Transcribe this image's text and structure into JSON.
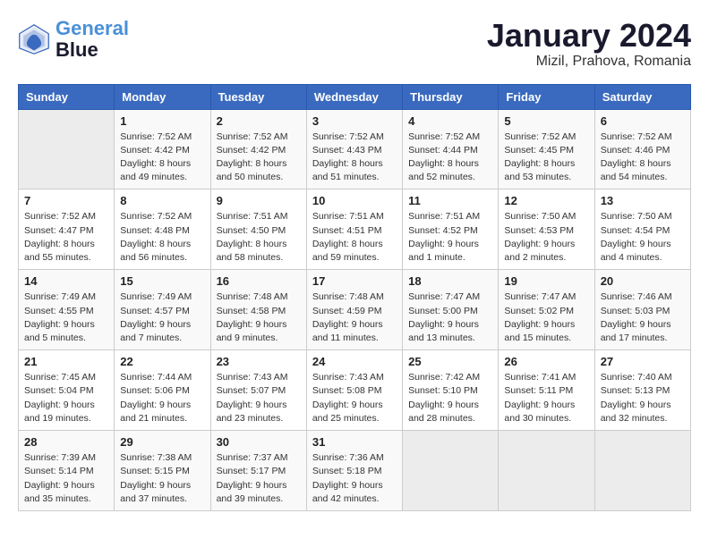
{
  "header": {
    "logo_line1": "General",
    "logo_line2": "Blue",
    "title": "January 2024",
    "subtitle": "Mizil, Prahova, Romania"
  },
  "weekdays": [
    "Sunday",
    "Monday",
    "Tuesday",
    "Wednesday",
    "Thursday",
    "Friday",
    "Saturday"
  ],
  "weeks": [
    [
      {
        "day": "",
        "sunrise": "",
        "sunset": "",
        "daylight": ""
      },
      {
        "day": "1",
        "sunrise": "Sunrise: 7:52 AM",
        "sunset": "Sunset: 4:42 PM",
        "daylight": "Daylight: 8 hours and 49 minutes."
      },
      {
        "day": "2",
        "sunrise": "Sunrise: 7:52 AM",
        "sunset": "Sunset: 4:42 PM",
        "daylight": "Daylight: 8 hours and 50 minutes."
      },
      {
        "day": "3",
        "sunrise": "Sunrise: 7:52 AM",
        "sunset": "Sunset: 4:43 PM",
        "daylight": "Daylight: 8 hours and 51 minutes."
      },
      {
        "day": "4",
        "sunrise": "Sunrise: 7:52 AM",
        "sunset": "Sunset: 4:44 PM",
        "daylight": "Daylight: 8 hours and 52 minutes."
      },
      {
        "day": "5",
        "sunrise": "Sunrise: 7:52 AM",
        "sunset": "Sunset: 4:45 PM",
        "daylight": "Daylight: 8 hours and 53 minutes."
      },
      {
        "day": "6",
        "sunrise": "Sunrise: 7:52 AM",
        "sunset": "Sunset: 4:46 PM",
        "daylight": "Daylight: 8 hours and 54 minutes."
      }
    ],
    [
      {
        "day": "7",
        "sunrise": "Sunrise: 7:52 AM",
        "sunset": "Sunset: 4:47 PM",
        "daylight": "Daylight: 8 hours and 55 minutes."
      },
      {
        "day": "8",
        "sunrise": "Sunrise: 7:52 AM",
        "sunset": "Sunset: 4:48 PM",
        "daylight": "Daylight: 8 hours and 56 minutes."
      },
      {
        "day": "9",
        "sunrise": "Sunrise: 7:51 AM",
        "sunset": "Sunset: 4:50 PM",
        "daylight": "Daylight: 8 hours and 58 minutes."
      },
      {
        "day": "10",
        "sunrise": "Sunrise: 7:51 AM",
        "sunset": "Sunset: 4:51 PM",
        "daylight": "Daylight: 8 hours and 59 minutes."
      },
      {
        "day": "11",
        "sunrise": "Sunrise: 7:51 AM",
        "sunset": "Sunset: 4:52 PM",
        "daylight": "Daylight: 9 hours and 1 minute."
      },
      {
        "day": "12",
        "sunrise": "Sunrise: 7:50 AM",
        "sunset": "Sunset: 4:53 PM",
        "daylight": "Daylight: 9 hours and 2 minutes."
      },
      {
        "day": "13",
        "sunrise": "Sunrise: 7:50 AM",
        "sunset": "Sunset: 4:54 PM",
        "daylight": "Daylight: 9 hours and 4 minutes."
      }
    ],
    [
      {
        "day": "14",
        "sunrise": "Sunrise: 7:49 AM",
        "sunset": "Sunset: 4:55 PM",
        "daylight": "Daylight: 9 hours and 5 minutes."
      },
      {
        "day": "15",
        "sunrise": "Sunrise: 7:49 AM",
        "sunset": "Sunset: 4:57 PM",
        "daylight": "Daylight: 9 hours and 7 minutes."
      },
      {
        "day": "16",
        "sunrise": "Sunrise: 7:48 AM",
        "sunset": "Sunset: 4:58 PM",
        "daylight": "Daylight: 9 hours and 9 minutes."
      },
      {
        "day": "17",
        "sunrise": "Sunrise: 7:48 AM",
        "sunset": "Sunset: 4:59 PM",
        "daylight": "Daylight: 9 hours and 11 minutes."
      },
      {
        "day": "18",
        "sunrise": "Sunrise: 7:47 AM",
        "sunset": "Sunset: 5:00 PM",
        "daylight": "Daylight: 9 hours and 13 minutes."
      },
      {
        "day": "19",
        "sunrise": "Sunrise: 7:47 AM",
        "sunset": "Sunset: 5:02 PM",
        "daylight": "Daylight: 9 hours and 15 minutes."
      },
      {
        "day": "20",
        "sunrise": "Sunrise: 7:46 AM",
        "sunset": "Sunset: 5:03 PM",
        "daylight": "Daylight: 9 hours and 17 minutes."
      }
    ],
    [
      {
        "day": "21",
        "sunrise": "Sunrise: 7:45 AM",
        "sunset": "Sunset: 5:04 PM",
        "daylight": "Daylight: 9 hours and 19 minutes."
      },
      {
        "day": "22",
        "sunrise": "Sunrise: 7:44 AM",
        "sunset": "Sunset: 5:06 PM",
        "daylight": "Daylight: 9 hours and 21 minutes."
      },
      {
        "day": "23",
        "sunrise": "Sunrise: 7:43 AM",
        "sunset": "Sunset: 5:07 PM",
        "daylight": "Daylight: 9 hours and 23 minutes."
      },
      {
        "day": "24",
        "sunrise": "Sunrise: 7:43 AM",
        "sunset": "Sunset: 5:08 PM",
        "daylight": "Daylight: 9 hours and 25 minutes."
      },
      {
        "day": "25",
        "sunrise": "Sunrise: 7:42 AM",
        "sunset": "Sunset: 5:10 PM",
        "daylight": "Daylight: 9 hours and 28 minutes."
      },
      {
        "day": "26",
        "sunrise": "Sunrise: 7:41 AM",
        "sunset": "Sunset: 5:11 PM",
        "daylight": "Daylight: 9 hours and 30 minutes."
      },
      {
        "day": "27",
        "sunrise": "Sunrise: 7:40 AM",
        "sunset": "Sunset: 5:13 PM",
        "daylight": "Daylight: 9 hours and 32 minutes."
      }
    ],
    [
      {
        "day": "28",
        "sunrise": "Sunrise: 7:39 AM",
        "sunset": "Sunset: 5:14 PM",
        "daylight": "Daylight: 9 hours and 35 minutes."
      },
      {
        "day": "29",
        "sunrise": "Sunrise: 7:38 AM",
        "sunset": "Sunset: 5:15 PM",
        "daylight": "Daylight: 9 hours and 37 minutes."
      },
      {
        "day": "30",
        "sunrise": "Sunrise: 7:37 AM",
        "sunset": "Sunset: 5:17 PM",
        "daylight": "Daylight: 9 hours and 39 minutes."
      },
      {
        "day": "31",
        "sunrise": "Sunrise: 7:36 AM",
        "sunset": "Sunset: 5:18 PM",
        "daylight": "Daylight: 9 hours and 42 minutes."
      },
      {
        "day": "",
        "sunrise": "",
        "sunset": "",
        "daylight": ""
      },
      {
        "day": "",
        "sunrise": "",
        "sunset": "",
        "daylight": ""
      },
      {
        "day": "",
        "sunrise": "",
        "sunset": "",
        "daylight": ""
      }
    ]
  ]
}
